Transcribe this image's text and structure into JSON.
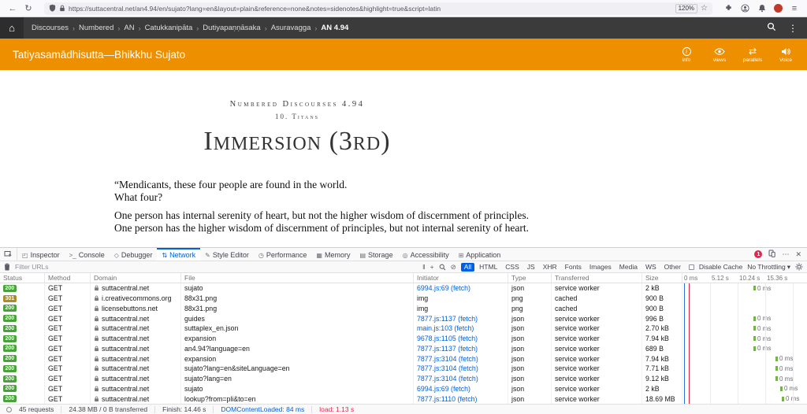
{
  "colors": {
    "accent_orange": "#ee8f00",
    "header_dark": "#3b3b3b",
    "status_ok_green": "#4aa13c",
    "status_redirect": "#ab8b2a",
    "devtools_blue": "#0060df",
    "error_red": "#e22850"
  },
  "browser": {
    "url": "https://suttacentral.net/an4.94/en/sujato?lang=en&layout=plain&reference=none&notes=sidenotes&highlight=true&script=latin",
    "zoom": "120%"
  },
  "sc_header": {
    "breadcrumbs": [
      "Discourses",
      "Numbered",
      "AN",
      "Catukkanipāta",
      "Dutiyapaṇṇāsaka",
      "Asuravagga"
    ],
    "current": "AN 4.94"
  },
  "sc_toolbar": {
    "title": "Tatiyasamādhisutta—Bhikkhu Sujato",
    "actions": [
      {
        "id": "info",
        "label": "info"
      },
      {
        "id": "views",
        "label": "views"
      },
      {
        "id": "parallels",
        "label": "parallels"
      },
      {
        "id": "voice",
        "label": "Voice"
      }
    ]
  },
  "content": {
    "collection": "Numbered Discourses 4.94",
    "chapter": "10. Titans",
    "title": "Immersion (3rd)",
    "paragraphs": [
      {
        "text": "“Mendicants, these four people are found in the world.",
        "gap": false
      },
      {
        "text": "What four?",
        "gap": false
      },
      {
        "text": "One person has internal serenity of heart, but not the higher wisdom of discernment of principles.",
        "gap": true
      },
      {
        "text": "One person has the higher wisdom of discernment of principles, but not internal serenity of heart.",
        "gap": false
      }
    ]
  },
  "devtools": {
    "tabs": [
      {
        "id": "inspector",
        "label": "Inspector",
        "icon": "inspector-icon",
        "active": false
      },
      {
        "id": "console",
        "label": "Console",
        "icon": "console-icon",
        "active": false
      },
      {
        "id": "debugger",
        "label": "Debugger",
        "icon": "debugger-icon",
        "active": false
      },
      {
        "id": "network",
        "label": "Network",
        "icon": "network-icon",
        "active": true
      },
      {
        "id": "style-editor",
        "label": "Style Editor",
        "icon": "style-editor-icon",
        "active": false
      },
      {
        "id": "performance",
        "label": "Performance",
        "icon": "performance-icon",
        "active": false
      },
      {
        "id": "memory",
        "label": "Memory",
        "icon": "memory-icon",
        "active": false
      },
      {
        "id": "storage",
        "label": "Storage",
        "icon": "storage-icon",
        "active": false
      },
      {
        "id": "accessibility",
        "label": "Accessibility",
        "icon": "accessibility-icon",
        "active": false
      },
      {
        "id": "application",
        "label": "Application",
        "icon": "application-icon",
        "active": false
      }
    ],
    "error_count": "1",
    "filter_placeholder": "Filter URLs",
    "type_filters": [
      "All",
      "HTML",
      "CSS",
      "JS",
      "XHR",
      "Fonts",
      "Images",
      "Media",
      "WS",
      "Other"
    ],
    "active_filter": "All",
    "disable_cache_label": "Disable Cache",
    "throttling_label": "No Throttling",
    "columns": [
      "Status",
      "Method",
      "Domain",
      "File",
      "Initiator",
      "Type",
      "Transferred",
      "Size"
    ],
    "timeline_ticks": [
      "0 ms",
      "5.12 s",
      "10.24 s",
      "15.36 s"
    ],
    "requests": [
      {
        "status": "200",
        "method": "GET",
        "domain": "suttacentral.net",
        "file": "sujato",
        "initiator": "6994.js:69 (fetch)",
        "initiator_link": true,
        "type": "json",
        "transferred": "service worker",
        "size": "2 kB",
        "time": "0 ms",
        "offset": 90
      },
      {
        "status": "301",
        "method": "GET",
        "domain": "i.creativecommons.org",
        "file": "88x31.png",
        "initiator": "img",
        "initiator_link": false,
        "type": "png",
        "transferred": "cached",
        "size": "900 B",
        "time": "",
        "offset": 0
      },
      {
        "status": "200",
        "method": "GET",
        "domain": "licensebuttons.net",
        "file": "88x31.png",
        "initiator": "img",
        "initiator_link": false,
        "type": "png",
        "transferred": "cached",
        "size": "900 B",
        "time": "",
        "offset": 0
      },
      {
        "status": "200",
        "method": "GET",
        "domain": "suttacentral.net",
        "file": "guides",
        "initiator": "7877.js:1137 (fetch)",
        "initiator_link": true,
        "type": "json",
        "transferred": "service worker",
        "size": "996 B",
        "time": "0 ms",
        "offset": 90
      },
      {
        "status": "200",
        "method": "GET",
        "domain": "suttacentral.net",
        "file": "suttaplex_en.json",
        "initiator": "main.js:103 (fetch)",
        "initiator_link": true,
        "type": "json",
        "transferred": "service worker",
        "size": "2.70 kB",
        "time": "0 ms",
        "offset": 90
      },
      {
        "status": "200",
        "method": "GET",
        "domain": "suttacentral.net",
        "file": "expansion",
        "initiator": "9678.js:1105 (fetch)",
        "initiator_link": true,
        "type": "json",
        "transferred": "service worker",
        "size": "7.94 kB",
        "time": "0 ms",
        "offset": 90
      },
      {
        "status": "200",
        "method": "GET",
        "domain": "suttacentral.net",
        "file": "an4.94?language=en",
        "initiator": "7877.js:1137 (fetch)",
        "initiator_link": true,
        "type": "json",
        "transferred": "service worker",
        "size": "689 B",
        "time": "0 ms",
        "offset": 90
      },
      {
        "status": "200",
        "method": "GET",
        "domain": "suttacentral.net",
        "file": "expansion",
        "initiator": "7877.js:3104 (fetch)",
        "initiator_link": true,
        "type": "json",
        "transferred": "service worker",
        "size": "7.94 kB",
        "time": "0 ms",
        "offset": 118
      },
      {
        "status": "200",
        "method": "GET",
        "domain": "suttacentral.net",
        "file": "sujato?lang=en&siteLanguage=en",
        "initiator": "7877.js:3104 (fetch)",
        "initiator_link": true,
        "type": "json",
        "transferred": "service worker",
        "size": "7.71 kB",
        "time": "0 ms",
        "offset": 118
      },
      {
        "status": "200",
        "method": "GET",
        "domain": "suttacentral.net",
        "file": "sujato?lang=en",
        "initiator": "7877.js:3104 (fetch)",
        "initiator_link": true,
        "type": "json",
        "transferred": "service worker",
        "size": "9.12 kB",
        "time": "0 ms",
        "offset": 118
      },
      {
        "status": "200",
        "method": "GET",
        "domain": "suttacentral.net",
        "file": "sujato",
        "initiator": "6994.js:69 (fetch)",
        "initiator_link": true,
        "type": "json",
        "transferred": "service worker",
        "size": "2 kB",
        "time": "0 ms",
        "offset": 124
      },
      {
        "status": "200",
        "method": "GET",
        "domain": "suttacentral.net",
        "file": "lookup?from=pli&to=en",
        "initiator": "7877.js:1110 (fetch)",
        "initiator_link": true,
        "type": "json",
        "transferred": "service worker",
        "size": "18.69 MB",
        "time": "0 ms",
        "offset": 126
      }
    ],
    "statusbar": {
      "requests": "45 requests",
      "transferred": "24.38 MB / 0 B transferred",
      "finish": "Finish: 14.46 s",
      "dcl": "DOMContentLoaded: 84 ms",
      "load": "load: 1.13 s"
    }
  }
}
